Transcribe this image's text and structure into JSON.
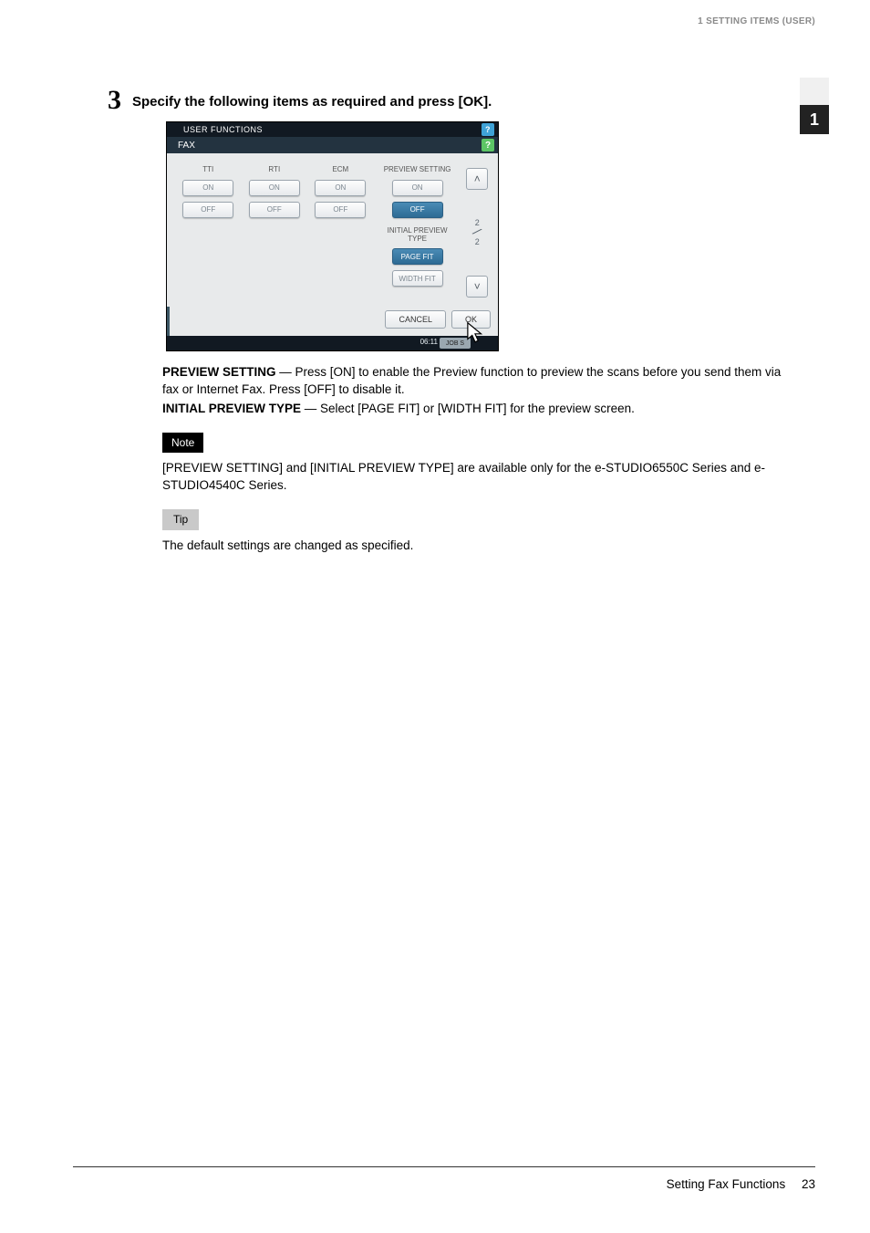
{
  "header": {
    "running_head": "1 SETTING ITEMS (USER)"
  },
  "side_tab": {
    "label": "1"
  },
  "step": {
    "number": "3",
    "title": "Specify the following items as required and press [OK]."
  },
  "screenshot": {
    "top_title": "USER FUNCTIONS",
    "tab": "FAX",
    "help_icon": "?",
    "columns": {
      "tti": {
        "label": "TTI",
        "on": "ON",
        "off": "OFF"
      },
      "rti": {
        "label": "RTI",
        "on": "ON",
        "off": "OFF"
      },
      "ecm": {
        "label": "ECM",
        "on": "ON",
        "off": "OFF"
      },
      "preview": {
        "label": "PREVIEW SETTING",
        "on": "ON",
        "off": "OFF",
        "type_label": "INITIAL PREVIEW TYPE",
        "page_fit": "PAGE FIT",
        "width_fit": "WIDTH FIT"
      }
    },
    "scroll": {
      "cur": "2",
      "total": "2"
    },
    "buttons": {
      "cancel": "CANCEL",
      "ok": "OK"
    },
    "status": {
      "time": "06:11",
      "job": "JOB S"
    }
  },
  "desc": {
    "preview_label": "PREVIEW SETTING",
    "preview_text": " — Press [ON] to enable the Preview function to preview the scans before you send them via fax or Internet Fax. Press [OFF] to disable it.",
    "initial_label": "INITIAL PREVIEW TYPE",
    "initial_text": " — Select [PAGE FIT] or [WIDTH FIT] for the preview screen."
  },
  "note": {
    "label": "Note",
    "text": "[PREVIEW SETTING] and [INITIAL PREVIEW TYPE] are available only for the e-STUDIO6550C Series and e-STUDIO4540C Series."
  },
  "tip": {
    "label": "Tip",
    "text": "The default settings are changed as specified."
  },
  "footer": {
    "section": "Setting Fax Functions",
    "page": "23"
  }
}
